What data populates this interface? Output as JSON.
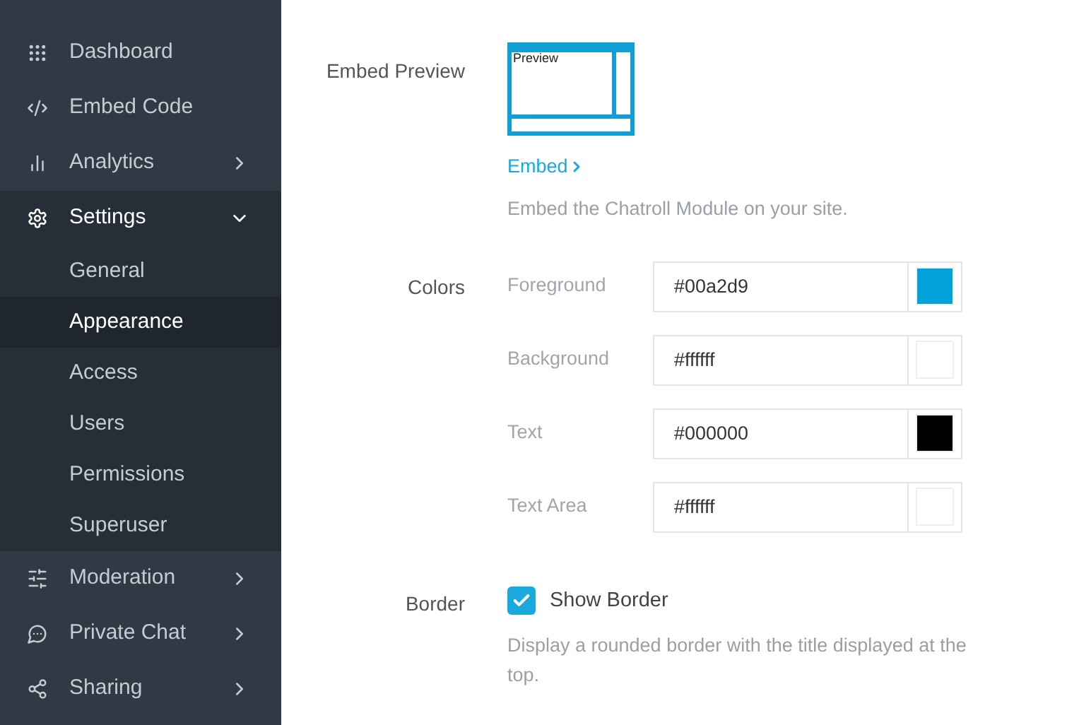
{
  "sidebar": {
    "items": [
      {
        "label": "Dashboard",
        "kind": "link"
      },
      {
        "label": "Embed Code",
        "kind": "link"
      },
      {
        "label": "Analytics",
        "kind": "group",
        "expanded": false
      },
      {
        "label": "Settings",
        "kind": "group",
        "expanded": true,
        "children": [
          {
            "label": "General",
            "selected": false
          },
          {
            "label": "Appearance",
            "selected": true
          },
          {
            "label": "Access",
            "selected": false
          },
          {
            "label": "Users",
            "selected": false
          },
          {
            "label": "Permissions",
            "selected": false
          },
          {
            "label": "Superuser",
            "selected": false
          }
        ]
      },
      {
        "label": "Moderation",
        "kind": "group",
        "expanded": false
      },
      {
        "label": "Private Chat",
        "kind": "group",
        "expanded": false
      },
      {
        "label": "Sharing",
        "kind": "group",
        "expanded": false
      }
    ]
  },
  "embed_preview": {
    "label": "Embed Preview",
    "preview_text": "Preview",
    "link": "Embed",
    "description": "Embed the Chatroll Module on your site."
  },
  "colors": {
    "label": "Colors",
    "rows": [
      {
        "name": "Foreground",
        "value": "#00a2d9",
        "color": "#00a2d9"
      },
      {
        "name": "Background",
        "value": "#ffffff",
        "color": "#ffffff"
      },
      {
        "name": "Text",
        "value": "#000000",
        "color": "#000000"
      },
      {
        "name": "Text Area",
        "value": "#ffffff",
        "color": "#ffffff"
      }
    ]
  },
  "border": {
    "label": "Border",
    "checkbox": "Show Border",
    "checked": true,
    "description": "Display a rounded border with the title displayed at the top."
  }
}
